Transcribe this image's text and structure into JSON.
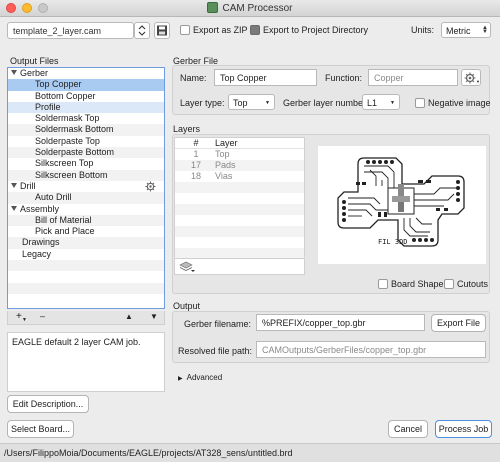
{
  "window": {
    "title": "CAM Processor"
  },
  "toolbar": {
    "template_file": "template_2_layer.cam",
    "export_zip_label": "Export as ZIP",
    "export_zip_checked": false,
    "export_project_dir_label": "Export to Project Directory",
    "export_project_dir_checked": true,
    "units_label": "Units:",
    "units_value": "Metric"
  },
  "output_files": {
    "header": "Output Files",
    "items": [
      {
        "label": "Gerber",
        "level": 0,
        "expanded": true
      },
      {
        "label": "Top Copper",
        "level": 1,
        "selected": true
      },
      {
        "label": "Bottom Copper",
        "level": 1
      },
      {
        "label": "Profile",
        "level": 1
      },
      {
        "label": "Soldermask Top",
        "level": 1
      },
      {
        "label": "Soldermask Bottom",
        "level": 1
      },
      {
        "label": "Solderpaste Top",
        "level": 1
      },
      {
        "label": "Solderpaste Bottom",
        "level": 1
      },
      {
        "label": "Silkscreen Top",
        "level": 1
      },
      {
        "label": "Silkscreen Bottom",
        "level": 1
      },
      {
        "label": "Drill",
        "level": 0,
        "expanded": true
      },
      {
        "label": "Auto Drill",
        "level": 1
      },
      {
        "label": "Assembly",
        "level": 0,
        "expanded": true
      },
      {
        "label": "Bill of Material",
        "level": 1
      },
      {
        "label": "Pick and Place",
        "level": 1
      },
      {
        "label": "Drawings",
        "level": 0
      },
      {
        "label": "Legacy",
        "level": 0
      }
    ],
    "add_label": "+",
    "remove_label": "–",
    "up_label": "▲",
    "down_label": "▼"
  },
  "description": {
    "text": "EAGLE default 2 layer CAM job.",
    "edit_button": "Edit Description..."
  },
  "gerber_file": {
    "section_title": "Gerber File",
    "name_label": "Name:",
    "name_value": "Top Copper",
    "function_label": "Function:",
    "function_placeholder": "Copper",
    "layer_type_label": "Layer type:",
    "layer_type_value": "Top",
    "gerber_layer_label": "Gerber layer numbe",
    "gerber_layer_value": "L1",
    "negative_image_label": "Negative image",
    "negative_image_checked": false
  },
  "layers": {
    "section_title": "Layers",
    "header_num": "#",
    "header_layer": "Layer",
    "rows": [
      {
        "num": "1",
        "name": "Top"
      },
      {
        "num": "17",
        "name": "Pads"
      },
      {
        "num": "18",
        "name": "Vias"
      }
    ],
    "board_shape_label": "Board Shape",
    "board_shape_checked": false,
    "cutouts_label": "Cutouts",
    "cutouts_checked": false
  },
  "output": {
    "section_title": "Output",
    "filename_label": "Gerber filename:",
    "filename_value": "%PREFIX/copper_top.gbr",
    "export_file_button": "Export File",
    "resolved_label": "Resolved file path:",
    "resolved_value": "CAMOutputs/GerberFiles/copper_top.gbr",
    "advanced_label": "Advanced"
  },
  "footer": {
    "select_board_button": "Select Board...",
    "cancel_button": "Cancel",
    "process_job_button": "Process Job",
    "board_path": "/Users/FilippoMoia/Documents/EAGLE/projects/AT328_sens/untitled.brd"
  },
  "preview": {
    "pcb_label": "FIL 3DD"
  },
  "colors": {
    "accent": "#4f8fe0",
    "selection": "#aacbf1"
  }
}
